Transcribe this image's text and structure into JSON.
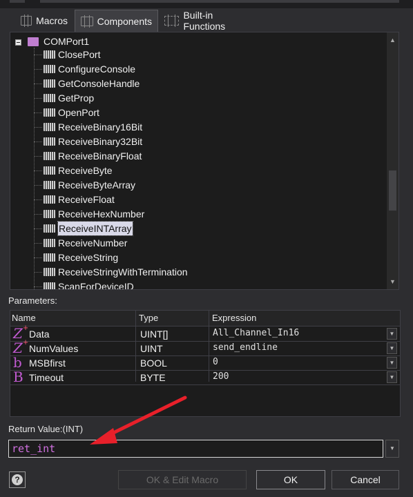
{
  "tabs": [
    {
      "label": "Macros",
      "icon": "macros-icon"
    },
    {
      "label": "Components",
      "icon": "components-icon",
      "active": true
    },
    {
      "label": "Built-in Functions",
      "icon": "functions-icon"
    }
  ],
  "tree": {
    "root": "COMPort1",
    "items": [
      "ClosePort",
      "ConfigureConsole",
      "GetConsoleHandle",
      "GetProp",
      "OpenPort",
      "ReceiveBinary16Bit",
      "ReceiveBinary32Bit",
      "ReceiveBinaryFloat",
      "ReceiveByte",
      "ReceiveByteArray",
      "ReceiveFloat",
      "ReceiveHexNumber",
      "ReceiveINTArray",
      "ReceiveNumber",
      "ReceiveString",
      "ReceiveStringWithTermination",
      "ScanForDeviceID"
    ],
    "selected": "ReceiveINTArray"
  },
  "parameters": {
    "label": "Parameters:",
    "columns": [
      "Name",
      "Type",
      "Expression"
    ],
    "rows": [
      {
        "icon": "Z",
        "arrayMark": "+",
        "name": "Data",
        "type": "UINT[]",
        "expression": "All_Channel_In16"
      },
      {
        "icon": "Z",
        "arrayMark": "+",
        "name": "NumValues",
        "type": "UINT",
        "expression": "send_endline"
      },
      {
        "icon": "b",
        "arrayMark": "",
        "name": "MSBfirst",
        "type": "BOOL",
        "expression": "0"
      },
      {
        "icon": "B",
        "arrayMark": "",
        "name": "Timeout",
        "type": "BYTE",
        "expression": "200"
      }
    ]
  },
  "return": {
    "label": "Return Value:(INT)",
    "value": "ret_int"
  },
  "buttons": {
    "help": "?",
    "ok_edit": "OK & Edit Macro",
    "ok": "OK",
    "cancel": "Cancel"
  },
  "colors": {
    "background": "#2d2d30",
    "panel": "#1c1c1c",
    "accent_purple": "#c07ed0",
    "annotation_arrow": "#e8202a"
  }
}
